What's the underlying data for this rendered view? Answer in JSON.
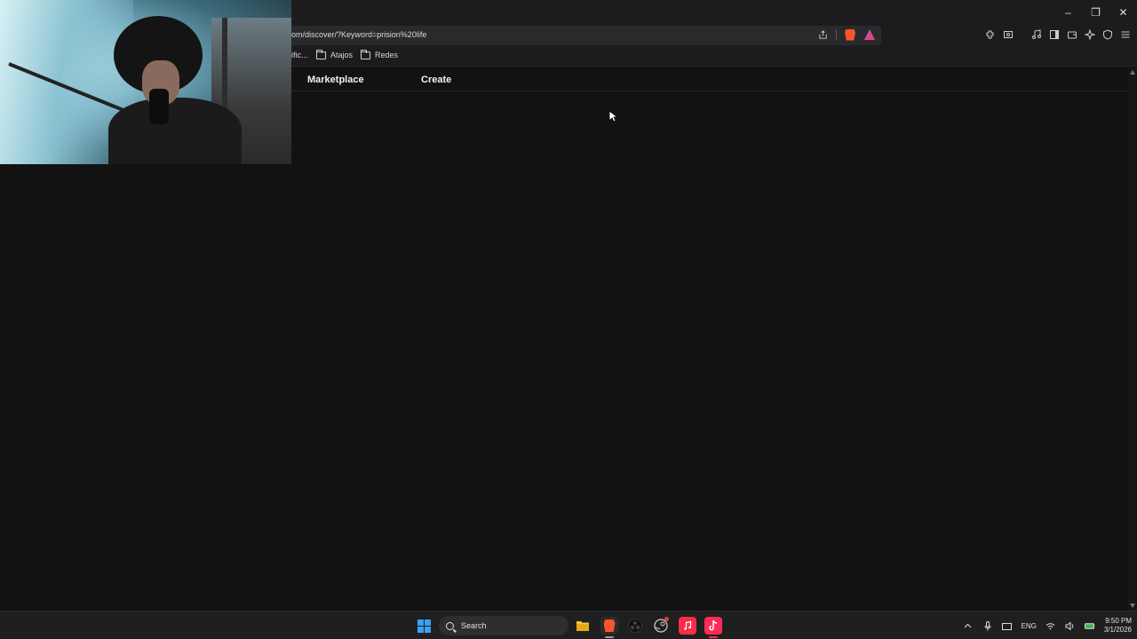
{
  "window": {
    "controls": {
      "minimize": "–",
      "restore": "❐",
      "close": "✕"
    }
  },
  "address_bar": {
    "url": "om/discover/?Keyword=prision%20life",
    "icons": [
      "share-icon",
      "brave-shields-icon",
      "brave-rewards-icon"
    ]
  },
  "toolbar_icons": [
    "extensions-icon",
    "screenshot-icon",
    "media-icon",
    "sidebar-icon",
    "wallet-icon",
    "leo-ai-icon",
    "vpn-icon",
    "menu-icon"
  ],
  "bookmarks": {
    "items": [
      {
        "label": "ific..."
      },
      {
        "label": "Atajos"
      },
      {
        "label": "Redes"
      }
    ]
  },
  "page": {
    "nav": [
      {
        "label": "Marketplace"
      },
      {
        "label": "Create"
      }
    ]
  },
  "taskbar": {
    "search_label": "Search",
    "apps": [
      "windows-start",
      "search",
      "file-explorer",
      "brave-browser",
      "obs-studio",
      "steam",
      "apple-music",
      "tiktok"
    ],
    "tray": {
      "language": "ENG",
      "time": "9:50 PM",
      "date": "3/1/2026"
    }
  },
  "colors": {
    "background": "#121213",
    "chrome": "#1c1c1e",
    "brave": "#fb542b",
    "tiktok": "#fe2c55",
    "music": "#fa2d48",
    "windows_blue": "#3aa0f3"
  }
}
